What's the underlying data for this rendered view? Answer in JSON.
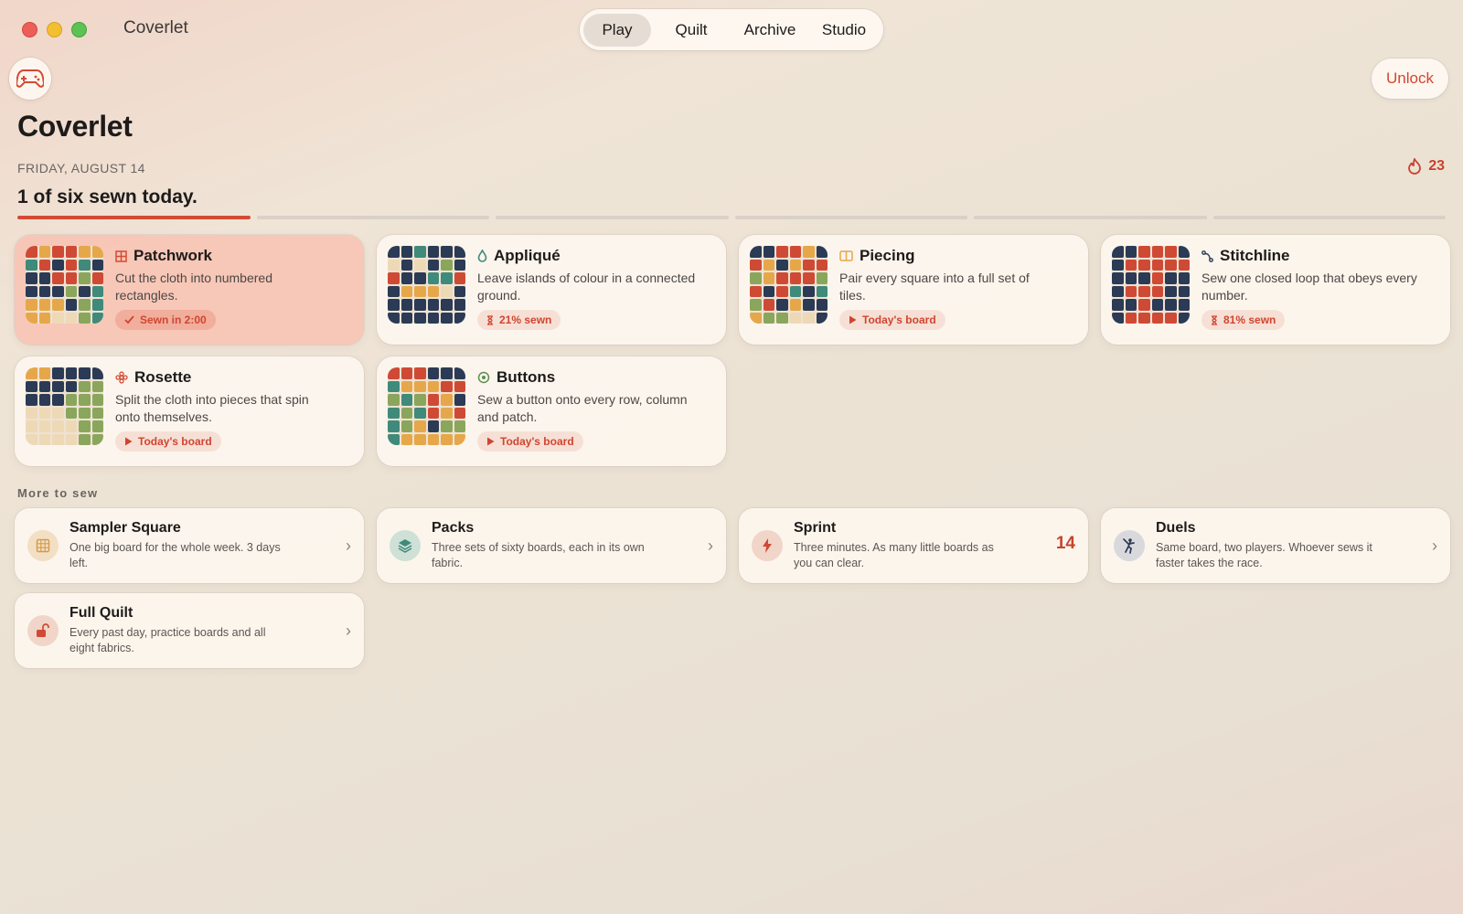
{
  "window": {
    "title": "Coverlet"
  },
  "nav": {
    "tabs": [
      "Play",
      "Quilt",
      "Archive",
      "Studio"
    ],
    "active": "Play"
  },
  "header": {
    "unlock_label": "Unlock",
    "title": "Coverlet",
    "date": "FRIDAY, AUGUST 14",
    "streak": "23",
    "progress_text": "1 of six sewn today.",
    "progress_segments": 6,
    "progress_done": 1
  },
  "colors": {
    "accent": "#d44a34",
    "navy": "#2b3a55",
    "teal": "#3f8a7a",
    "red": "#cf4a35",
    "mustard": "#e6a74a",
    "olive": "#8aa65c",
    "cream": "#eed9b6"
  },
  "puzzles": [
    {
      "name": "Patchwork",
      "icon": "grid-icon",
      "desc": "Cut the cloth into numbered rectangles.",
      "status": "Sewn in 2:00",
      "status_icon": "checkmark-icon",
      "highlight": true
    },
    {
      "name": "Appliqué",
      "icon": "drop-icon",
      "desc": "Leave islands of colour in a connected ground.",
      "status": "21% sewn",
      "status_icon": "hourglass-icon"
    },
    {
      "name": "Piecing",
      "icon": "book-icon",
      "desc": "Pair every square into a full set of tiles.",
      "status": "Today's board",
      "status_icon": "play-icon"
    },
    {
      "name": "Stitchline",
      "icon": "path-icon",
      "desc": "Sew one closed loop that obeys every number.",
      "status": "81% sewn",
      "status_icon": "hourglass-icon"
    },
    {
      "name": "Rosette",
      "icon": "flower-icon",
      "desc": "Split the cloth into pieces that spin onto themselves.",
      "status": "Today's board",
      "status_icon": "play-icon"
    },
    {
      "name": "Buttons",
      "icon": "target-icon",
      "desc": "Sew a button onto every row, column and patch.",
      "status": "Today's board",
      "status_icon": "play-icon"
    }
  ],
  "more": {
    "title": "More to sew",
    "items": [
      {
        "name": "Sampler Square",
        "desc": "One big board for the whole week. 3 days left.",
        "icon": "grid-icon"
      },
      {
        "name": "Packs",
        "desc": "Three sets of sixty boards, each in its own fabric.",
        "icon": "stack-icon"
      },
      {
        "name": "Sprint",
        "desc": "Three minutes. As many little boards as you can clear.",
        "icon": "bolt-icon",
        "count": "14"
      },
      {
        "name": "Duels",
        "desc": "Same board, two players. Whoever sews it faster takes the race.",
        "icon": "fencing-icon"
      },
      {
        "name": "Full Quilt",
        "desc": "Every past day, practice boards and all eight fabrics.",
        "icon": "unlock-icon"
      }
    ]
  }
}
